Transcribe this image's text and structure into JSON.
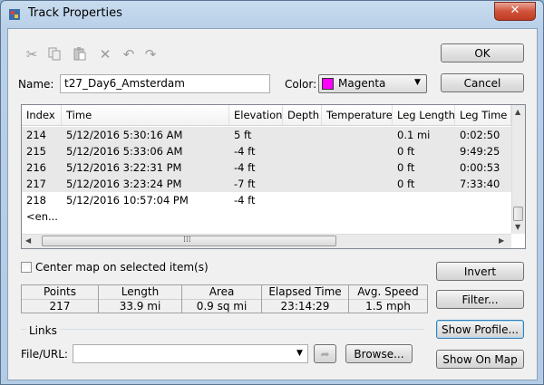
{
  "window": {
    "title": "Track Properties",
    "close_glyph": "✕"
  },
  "toolbar": {
    "icons": [
      "scissors-icon",
      "copy-icon",
      "paste-icon",
      "delete-icon",
      "undo-icon",
      "redo-icon"
    ]
  },
  "name_field": {
    "label": "Name:",
    "value": "t27_Day6_Amsterdam"
  },
  "color_field": {
    "label": "Color:",
    "value": "Magenta",
    "swatch": "#ff00ff"
  },
  "buttons": {
    "ok": "OK",
    "cancel": "Cancel",
    "invert": "Invert",
    "filter": "Filter...",
    "show_profile": "Show Profile...",
    "show_on_map": "Show On Map",
    "browse": "Browse..."
  },
  "table": {
    "columns": [
      "Index",
      "Time",
      "Elevation",
      "Depth",
      "Temperature",
      "Leg Length",
      "Leg Time"
    ],
    "rows": [
      [
        "214",
        "5/12/2016 5:30:16 AM",
        "5 ft",
        "",
        "",
        "0.1 mi",
        "0:02:50"
      ],
      [
        "215",
        "5/12/2016 5:33:06 AM",
        "-4 ft",
        "",
        "",
        "0 ft",
        "9:49:25"
      ],
      [
        "216",
        "5/12/2016 3:22:31 PM",
        "-4 ft",
        "",
        "",
        "0 ft",
        "0:00:53"
      ],
      [
        "217",
        "5/12/2016 3:23:24 PM",
        "-7 ft",
        "",
        "",
        "0 ft",
        "7:33:40"
      ],
      [
        "218",
        "5/12/2016 10:57:04 PM",
        "-4 ft",
        "",
        "",
        "",
        ""
      ]
    ],
    "end_row": "<en..."
  },
  "center_map": {
    "label": "Center map on selected item(s)",
    "checked": false
  },
  "stats": {
    "headers": [
      "Points",
      "Length",
      "Area",
      "Elapsed Time",
      "Avg. Speed"
    ],
    "values": [
      "217",
      "33.9 mi",
      "0.9 sq mi",
      "23:14:29",
      "1.5 mph"
    ]
  },
  "links": {
    "group_label": "Links",
    "file_label": "File/URL:",
    "value": ""
  }
}
